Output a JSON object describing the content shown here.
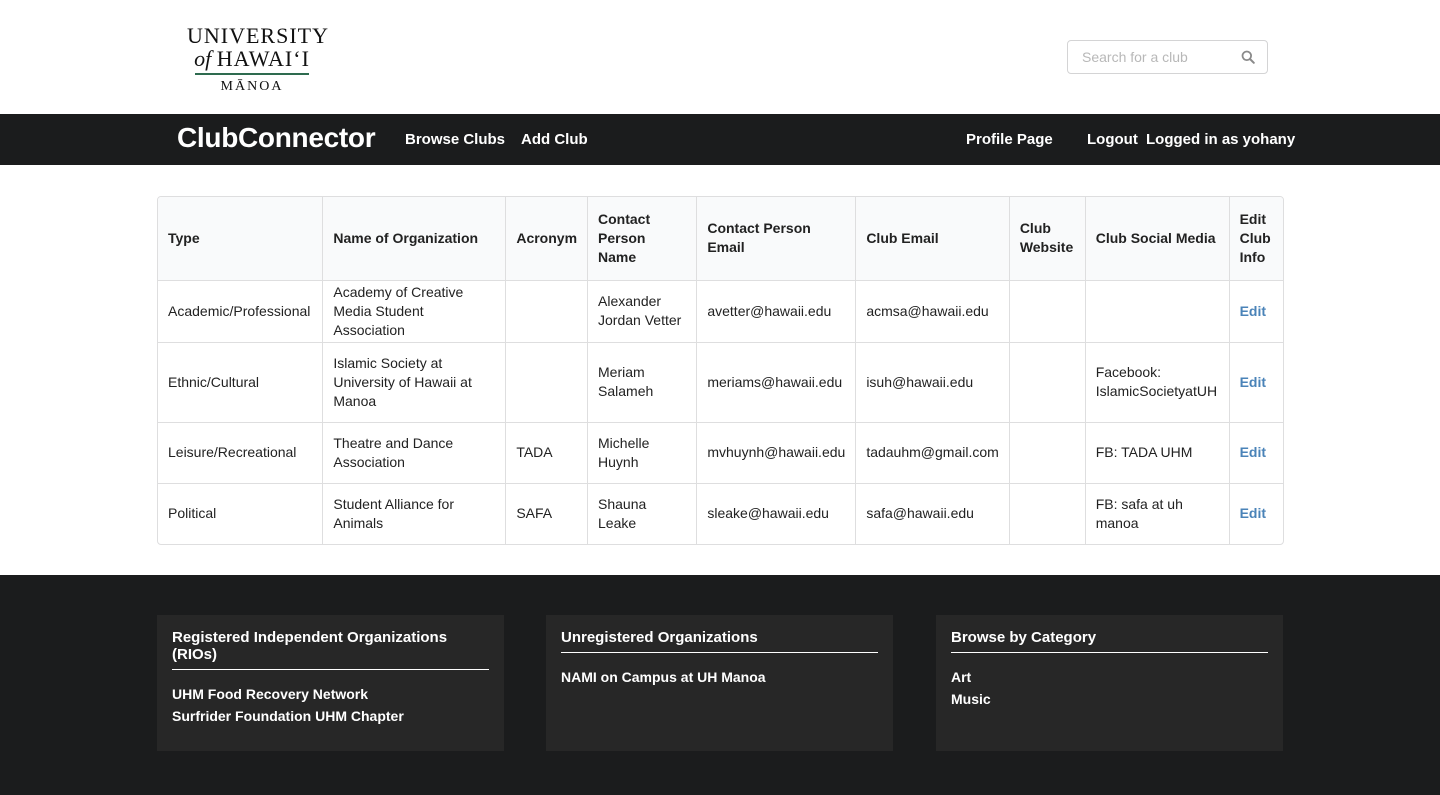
{
  "logo": {
    "line1": "UNIVERSITY",
    "line2_of": "of",
    "line2_rest": "HAWAIʻI",
    "line3": "MĀNOA"
  },
  "search": {
    "placeholder": "Search for a club",
    "icon": "search-icon"
  },
  "navbar": {
    "brand": "ClubConnector",
    "browse_clubs": "Browse Clubs",
    "add_club": "Add Club",
    "profile_page": "Profile Page",
    "logout": "Logout",
    "logged_in": "Logged in as yohany"
  },
  "table": {
    "headers": [
      "Type",
      "Name of Organization",
      "Acronym",
      "Contact Person Name",
      "Contact Person Email",
      "Club Email",
      "Club Website",
      "Club Social Media",
      "Edit Club Info"
    ],
    "rows": [
      {
        "type": "Academic/Professional",
        "name": "Academy of Creative Media Student Association",
        "acronym": "",
        "contact_name": "Alexander Jordan Vetter",
        "contact_email": "avetter@hawaii.edu",
        "club_email": "acmsa@hawaii.edu",
        "website": "",
        "social": "",
        "edit": "Edit"
      },
      {
        "type": "Ethnic/Cultural",
        "name": "Islamic Society at University of Hawaii at Manoa",
        "acronym": "",
        "contact_name": "Meriam Salameh",
        "contact_email": "meriams@hawaii.edu",
        "club_email": "isuh@hawaii.edu",
        "website": "",
        "social": "Facebook: IslamicSocietyatUH",
        "edit": "Edit"
      },
      {
        "type": "Leisure/Recreational",
        "name": "Theatre and Dance Association",
        "acronym": "TADA",
        "contact_name": "Michelle Huynh",
        "contact_email": "mvhuynh@hawaii.edu",
        "club_email": "tadauhm@gmail.com",
        "website": "",
        "social": "FB: TADA UHM",
        "edit": "Edit"
      },
      {
        "type": "Political",
        "name": "Student Alliance for Animals",
        "acronym": "SAFA",
        "contact_name": "Shauna Leake",
        "contact_email": "sleake@hawaii.edu",
        "club_email": "safa@hawaii.edu",
        "website": "",
        "social": "FB: safa at uh manoa",
        "edit": "Edit"
      }
    ]
  },
  "footer": {
    "rios": {
      "title": "Registered Independent Organizations (RIOs)",
      "links": [
        "UHM Food Recovery Network",
        "Surfrider Foundation UHM Chapter"
      ]
    },
    "unregistered": {
      "title": "Unregistered Organizations",
      "links": [
        "NAMI on Campus at UH Manoa"
      ]
    },
    "category": {
      "title": "Browse by Category",
      "links": [
        "Art",
        "Music"
      ]
    }
  },
  "colors": {
    "navbar_bg": "#1b1c1d",
    "footer_panel": "#272727",
    "link_blue": "#4a83b8",
    "logo_rule": "#2e6b4f"
  }
}
